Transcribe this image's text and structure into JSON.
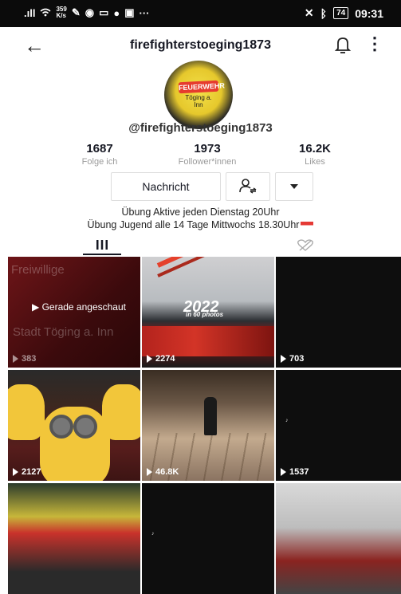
{
  "status_bar": {
    "signal_text": ".ıll",
    "speed_value": "359",
    "speed_unit": "K/s",
    "battery": "74",
    "time": "09:31"
  },
  "header": {
    "title": "firefighterstoeging1873"
  },
  "profile": {
    "avatar_text_line1": "FEUERWEHR",
    "avatar_text_line2": "Töging a. Inn",
    "username": "@firefighterstoeging1873",
    "stats": [
      {
        "value": "1687",
        "label": "Folge ich"
      },
      {
        "value": "1973",
        "label": "Follower*innen"
      },
      {
        "value": "16.2K",
        "label": "Likes"
      }
    ],
    "message_button": "Nachricht",
    "bio_line1": "Übung Aktive jeden Dienstag 20Uhr",
    "bio_line2": "Übung Jugend alle 14 Tage Mittwochs 18.30Uhr"
  },
  "tabs": {
    "active": "videos"
  },
  "videos": [
    {
      "views": "383",
      "overlay": "Gerade angeschaut",
      "watermark1": "Freiwillige",
      "watermark2": "Stadt Töging a. Inn"
    },
    {
      "views": "2274",
      "title_overlay": "2022",
      "sub_overlay": "in 60 photos"
    },
    {
      "views": "703"
    },
    {
      "views": "2127"
    },
    {
      "views": "46.8K"
    },
    {
      "views": "1537"
    },
    {
      "views": ""
    },
    {
      "views": ""
    },
    {
      "views": ""
    }
  ],
  "colors": {
    "status_bg": "#0b0b0b",
    "text_primary": "#161823",
    "text_secondary": "#9b9b9b",
    "accent_red": "#e53935"
  }
}
